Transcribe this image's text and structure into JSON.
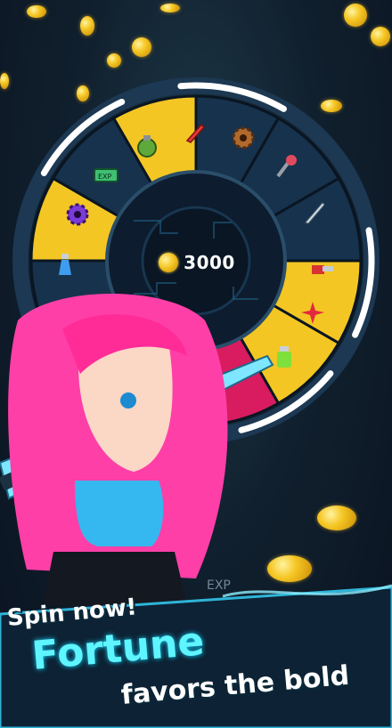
{
  "wheel": {
    "center_amount": "3000",
    "center_icon": "gold-coin-icon",
    "rewards": [
      {
        "icon": "grenade-icon",
        "highlighted": true
      },
      {
        "icon": "red-knife-icon",
        "highlighted": false
      },
      {
        "icon": "bronze-gear-icon",
        "highlighted": false
      },
      {
        "icon": "spiked-club-icon",
        "highlighted": false
      },
      {
        "icon": "silver-sword-icon",
        "highlighted": true
      },
      {
        "icon": "chainsaw-icon",
        "highlighted": true
      },
      {
        "icon": "red-shuriken-icon",
        "highlighted": true
      },
      {
        "icon": "green-potion-icon",
        "highlighted": false
      },
      {
        "icon": "exp-ticket-icon",
        "highlighted": false
      },
      {
        "icon": "blue-potion-icon",
        "highlighted": false
      },
      {
        "icon": "purple-gear-icon",
        "highlighted": true
      },
      {
        "icon": "exp-ticket-icon",
        "highlighted": false
      }
    ],
    "highlight_color": "#f3c623",
    "selected_color": "#d81c5f",
    "slot_color": "#17324c"
  },
  "character": {
    "hair_color": "#ff3fa8",
    "top_color": "#35b8f0",
    "blade_color": "#7fe6ff"
  },
  "promo": {
    "line1": "Spin now!",
    "line2": "Fortune",
    "line3": "favors the bold"
  },
  "background_text": "EXP"
}
